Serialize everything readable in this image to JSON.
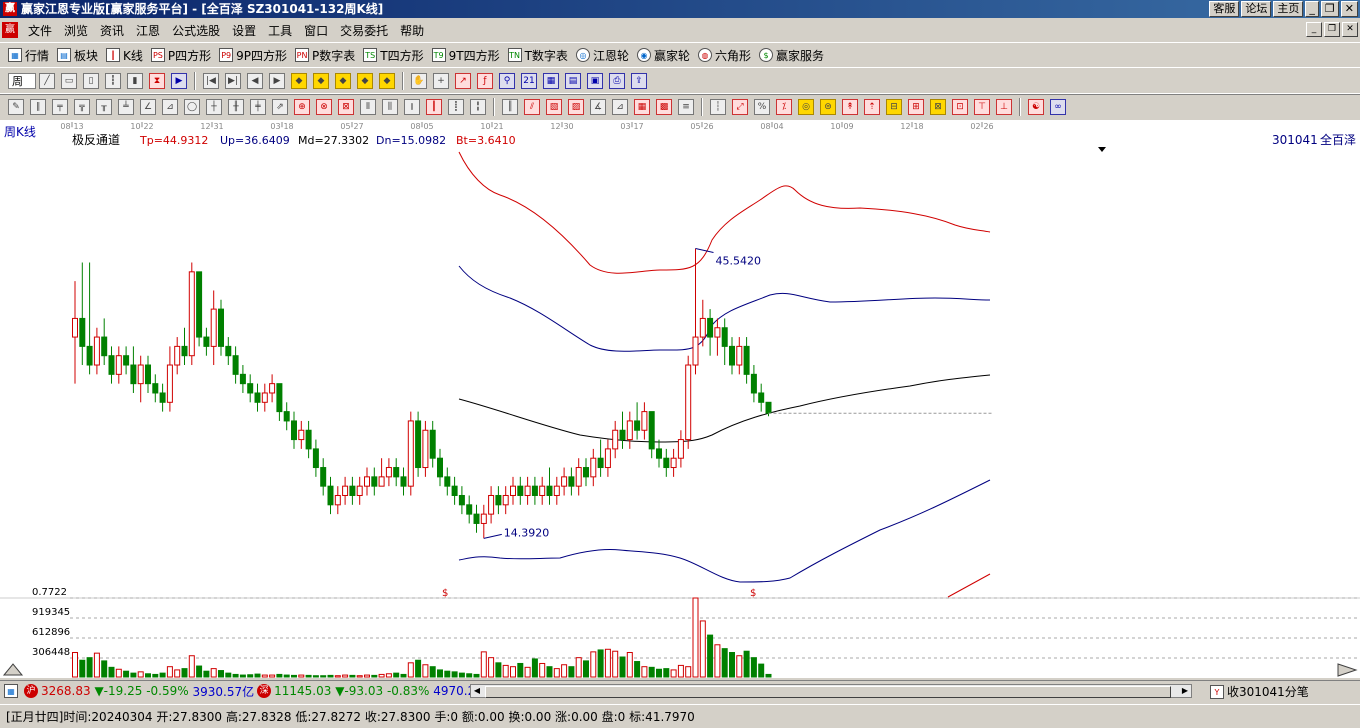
{
  "app": {
    "title": "赢家江恩专业版[赢家服务平台] - [全百泽  SZ301041-132周K线]",
    "logo_char": "赢",
    "title_buttons": [
      "客服",
      "论坛",
      "主页"
    ]
  },
  "menu": [
    "文件",
    "浏览",
    "资讯",
    "江恩",
    "公式选股",
    "设置",
    "工具",
    "窗口",
    "交易委托",
    "帮助"
  ],
  "toolbar1": [
    {
      "icon": "grid-icon",
      "label": "行情"
    },
    {
      "icon": "block-icon",
      "label": "板块"
    },
    {
      "icon": "kline-icon",
      "label": "K线"
    },
    {
      "icon": "p-square-icon",
      "glyph": "PS",
      "label": "P四方形"
    },
    {
      "icon": "nine-p-icon",
      "glyph": "P9",
      "label": "9P四方形"
    },
    {
      "icon": "pn-icon",
      "glyph": "PN",
      "label": "P数字表"
    },
    {
      "icon": "t-square-icon",
      "glyph": "TS",
      "label": "T四方形"
    },
    {
      "icon": "nine-t-icon",
      "glyph": "T9",
      "label": "9T四方形"
    },
    {
      "icon": "tn-icon",
      "glyph": "TN",
      "label": "T数字表"
    },
    {
      "icon": "wheel-icon",
      "label": "江恩轮"
    },
    {
      "icon": "wheel2-icon",
      "label": "赢家轮"
    },
    {
      "icon": "hexagon-icon",
      "label": "六角形"
    },
    {
      "icon": "dollar-icon",
      "label": "赢家服务"
    }
  ],
  "period_select": "周",
  "chart_header": {
    "period": "周K线",
    "indicator": "极反通道",
    "tp": "Tp=44.9312",
    "up": "Up=36.6409",
    "md": "Md=27.3302",
    "dn": "Dn=15.0982",
    "bt": "Bt=3.6410",
    "code": "301041",
    "name": "全百泽"
  },
  "annotations": {
    "high": "45.5420",
    "low": "14.3920"
  },
  "colors": {
    "up": "#d00000",
    "down": "#008000",
    "upper_band": "#d00000",
    "band": "#000080",
    "mid": "#000000"
  },
  "chart_data": {
    "type": "candlestick",
    "title": "",
    "x_tick_labels": [
      "08-13",
      "10-22",
      "12-31",
      "03-18",
      "05-27",
      "08-05",
      "10-21",
      "12-30",
      "03-17",
      "05-26",
      "08-04",
      "10-09",
      "12-18",
      "02-26"
    ],
    "ylim": [
      8,
      55
    ],
    "last_close": 27.83,
    "candles": [
      [
        36,
        38,
        42,
        31
      ],
      [
        38,
        35,
        44,
        33
      ],
      [
        35,
        33,
        44,
        32
      ],
      [
        33,
        36,
        37,
        32
      ],
      [
        36,
        34,
        38,
        33
      ],
      [
        34,
        32,
        35,
        31
      ],
      [
        32,
        34,
        35,
        31
      ],
      [
        34,
        33,
        35,
        32
      ],
      [
        33,
        31,
        35,
        30
      ],
      [
        31,
        33,
        34,
        29
      ],
      [
        33,
        31,
        34,
        30
      ],
      [
        31,
        30,
        32,
        29
      ],
      [
        30,
        29,
        31,
        28
      ],
      [
        29,
        33,
        35,
        28
      ],
      [
        33,
        35,
        36,
        32
      ],
      [
        35,
        34,
        37,
        33
      ],
      [
        34,
        43,
        44,
        33
      ],
      [
        43,
        36,
        43,
        35
      ],
      [
        36,
        35,
        37,
        34
      ],
      [
        35,
        39,
        41,
        33
      ],
      [
        39,
        35,
        40,
        34
      ],
      [
        35,
        34,
        36,
        33
      ],
      [
        34,
        32,
        35,
        31
      ],
      [
        32,
        31,
        33,
        30
      ],
      [
        31,
        30,
        32,
        29
      ],
      [
        30,
        29,
        31,
        28
      ],
      [
        29,
        30,
        31,
        28
      ],
      [
        30,
        31,
        32,
        29
      ],
      [
        31,
        28,
        31,
        27
      ],
      [
        28,
        27,
        29,
        26
      ],
      [
        27,
        25,
        28,
        24
      ],
      [
        25,
        26,
        27,
        24
      ],
      [
        26,
        24,
        27,
        23
      ],
      [
        24,
        22,
        25,
        21
      ],
      [
        22,
        20,
        23,
        19
      ],
      [
        20,
        18,
        21,
        17
      ],
      [
        18,
        19,
        20,
        17
      ],
      [
        19,
        20,
        21,
        18
      ],
      [
        20,
        19,
        21,
        18
      ],
      [
        19,
        20,
        21,
        18
      ],
      [
        20,
        21,
        22,
        19
      ],
      [
        21,
        20,
        22,
        19
      ],
      [
        20,
        21,
        23,
        20
      ],
      [
        21,
        22,
        23,
        20
      ],
      [
        22,
        21,
        23,
        20
      ],
      [
        21,
        20,
        22,
        19
      ],
      [
        20,
        27,
        28,
        19
      ],
      [
        27,
        22,
        28,
        21
      ],
      [
        22,
        26,
        27,
        21
      ],
      [
        26,
        23,
        27,
        22
      ],
      [
        23,
        21,
        24,
        20
      ],
      [
        21,
        20,
        22,
        19
      ],
      [
        20,
        19,
        21,
        18
      ],
      [
        19,
        18,
        20,
        17
      ],
      [
        18,
        17,
        19,
        16
      ],
      [
        17,
        16,
        18,
        15
      ],
      [
        16,
        17,
        18,
        14.4
      ],
      [
        17,
        19,
        20,
        16
      ],
      [
        19,
        18,
        20,
        17
      ],
      [
        18,
        19,
        20,
        17
      ],
      [
        19,
        20,
        21,
        18
      ],
      [
        20,
        19,
        21,
        18
      ],
      [
        19,
        20,
        21,
        18
      ],
      [
        20,
        19,
        21,
        18
      ],
      [
        19,
        20,
        21,
        18
      ],
      [
        20,
        19,
        22,
        18
      ],
      [
        19,
        20,
        21,
        18
      ],
      [
        20,
        21,
        22,
        19
      ],
      [
        21,
        20,
        22,
        19
      ],
      [
        20,
        22,
        23,
        19
      ],
      [
        22,
        21,
        23,
        20
      ],
      [
        21,
        23,
        24,
        20
      ],
      [
        23,
        22,
        25,
        21
      ],
      [
        22,
        24,
        25,
        21
      ],
      [
        24,
        26,
        27,
        23
      ],
      [
        26,
        25,
        28,
        24
      ],
      [
        25,
        27,
        28,
        24
      ],
      [
        27,
        26,
        29,
        25
      ],
      [
        26,
        28,
        29,
        25
      ],
      [
        28,
        24,
        28,
        23
      ],
      [
        24,
        23,
        25,
        22
      ],
      [
        23,
        22,
        24,
        21
      ],
      [
        22,
        23,
        24,
        21
      ],
      [
        23,
        25,
        26,
        22
      ],
      [
        25,
        33,
        34,
        24
      ],
      [
        33,
        36,
        45.5,
        32
      ],
      [
        36,
        38,
        40,
        35
      ],
      [
        38,
        36,
        39,
        34
      ],
      [
        36,
        37,
        38,
        34
      ],
      [
        37,
        35,
        38,
        33
      ],
      [
        35,
        33,
        36,
        32
      ],
      [
        33,
        35,
        36,
        32
      ],
      [
        35,
        32,
        36,
        31
      ],
      [
        32,
        30,
        33,
        29
      ],
      [
        30,
        29,
        31,
        28
      ],
      [
        29,
        27.83,
        29,
        27.5
      ]
    ],
    "volume_axis_labels": [
      "0.7722",
      "919345",
      "612896",
      "306448"
    ],
    "volume_max": 1225793,
    "volumes": [
      380000,
      260000,
      300000,
      370000,
      250000,
      150000,
      120000,
      90000,
      60000,
      80000,
      50000,
      40000,
      60000,
      160000,
      110000,
      130000,
      330000,
      170000,
      90000,
      130000,
      100000,
      60000,
      40000,
      30000,
      35000,
      45000,
      30000,
      30000,
      40000,
      30000,
      25000,
      30000,
      25000,
      20000,
      20000,
      25000,
      20000,
      30000,
      25000,
      20000,
      30000,
      25000,
      40000,
      50000,
      60000,
      40000,
      220000,
      260000,
      190000,
      160000,
      110000,
      90000,
      80000,
      60000,
      50000,
      40000,
      390000,
      300000,
      220000,
      180000,
      160000,
      210000,
      150000,
      280000,
      210000,
      160000,
      130000,
      190000,
      160000,
      300000,
      250000,
      390000,
      420000,
      430000,
      400000,
      310000,
      380000,
      240000,
      160000,
      150000,
      120000,
      130000,
      110000,
      180000,
      160000,
      1225793,
      870000,
      650000,
      500000,
      440000,
      380000,
      330000,
      400000,
      300000,
      200000,
      40000
    ]
  },
  "bottom_bar": {
    "sh_badge": "沪",
    "sh_value": "3268.83",
    "sh_change": "▼-19.25",
    "sh_pct": "-0.59%",
    "sh_amount": "3930.57亿",
    "sz_badge": "深",
    "sz_value": "11145.03",
    "sz_change": "▼-93.03",
    "sz_pct": "-0.83%",
    "sz_amount": "4970.2",
    "receive": "收301041分笔"
  },
  "status": {
    "lunar": "[正月廿四]",
    "time": "时间:20240304",
    "open": "开:27.8300",
    "high": "高:27.8328",
    "low": "低:27.8272",
    "close": "收:27.8300",
    "hand": "手:0",
    "amount": "额:0.00",
    "turnover": "换:0.00",
    "rise": "涨:0.00",
    "pan": "盘:0",
    "mark": "标:41.7970"
  }
}
